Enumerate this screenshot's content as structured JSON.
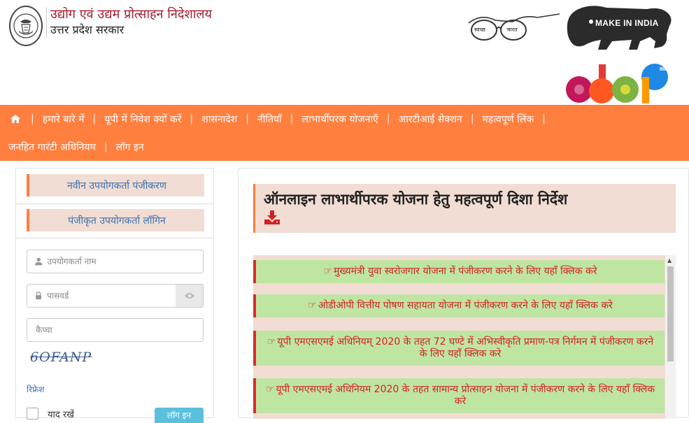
{
  "header": {
    "org_line1": "उद्योग एवं उद्यम प्रोत्साहन निदेशालय",
    "org_line2": "उत्तर प्रदेश सरकार",
    "swachh_left": "स्वच्छ",
    "swachh_right": "भारत",
    "make_in_india": "MAKE IN INDIA"
  },
  "nav": {
    "row1": [
      {
        "label": "हमारे बारे में"
      },
      {
        "label": "यूपी में निवेश क्यों करें"
      },
      {
        "label": "शासनादेश"
      },
      {
        "label": "नीतियाँ"
      },
      {
        "label": "लाभार्थीपरक योजनाएँ"
      },
      {
        "label": "आरटीआई सेक्शन"
      },
      {
        "label": "महत्वपूर्ण लिंक"
      }
    ],
    "row2": [
      {
        "label": "जनहित गारंटी अधिनियम"
      },
      {
        "label": "लॉग इन"
      }
    ]
  },
  "left": {
    "tab_register": "नवीन उपयोगकर्ता पंजीकरण",
    "tab_login": "पंजीकृत उपयोगकर्ता लॉगिन",
    "username_placeholder": "उपयोगकर्ता नाम",
    "password_placeholder": "पासवर्ड",
    "captcha_placeholder": "कैप्चा",
    "captcha_text": "6OFANP",
    "refresh": "रिफ्रेश",
    "remember": "याद रखें",
    "login_button": "लॉग इन"
  },
  "main": {
    "notice_title": "ऑनलाइन लाभार्थीपरक योजना हेतु महत्वपूर्ण दिशा निर्देश",
    "items": [
      {
        "text": "मुख्यमंत्री युवा स्वरोजगार योजना में पंजीकरण करने के लिए यहाँ क्लिक करे"
      },
      {
        "text": "ओडीओपी वित्तीय पोषण सहायता योजना में पंजीकरण करने के लिए यहाँ क्लिक करे"
      },
      {
        "text": "यूपी एमएसएमई अधिनियम् 2020 के तहत 72 घण्टे में अभिस्वीकृति प्रमाण-पत्र निर्गमन में पंजीकरण करने के लिए यहाँ क्लिक करे"
      },
      {
        "text": "यूपी एमएसएमई अधिनियम 2020 के तहत सामान्य प्रोत्साहन योजना में पंजीकरण करने के लिए यहाँ क्लिक करे"
      }
    ]
  },
  "colors": {
    "nav_orange": "#ff7f3f",
    "item_green": "#bfe5a3",
    "item_red": "#d42020",
    "tab_peach": "#f1ddd3",
    "link_blue": "#3a6fb3"
  }
}
